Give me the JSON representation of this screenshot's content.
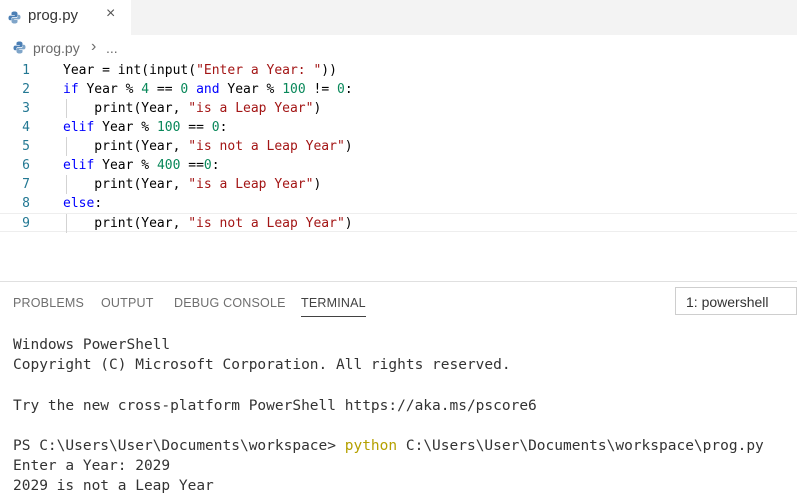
{
  "tab": {
    "filename": "prog.py",
    "close": "×"
  },
  "breadcrumb": {
    "file": "prog.py",
    "separator": "›",
    "more": "..."
  },
  "editor": {
    "lines": [
      {
        "n": "1",
        "segments": [
          [
            "t",
            "Year = int(input("
          ],
          [
            "s",
            "\"Enter a Year: \""
          ],
          [
            "t",
            "))"
          ]
        ],
        "indent": false
      },
      {
        "n": "2",
        "segments": [
          [
            "k",
            "if"
          ],
          [
            "t",
            " Year % "
          ],
          [
            "n",
            "4"
          ],
          [
            "t",
            " == "
          ],
          [
            "n",
            "0"
          ],
          [
            "t",
            " "
          ],
          [
            "k",
            "and"
          ],
          [
            "t",
            " Year % "
          ],
          [
            "n",
            "100"
          ],
          [
            "t",
            " != "
          ],
          [
            "n",
            "0"
          ],
          [
            "t",
            ":"
          ]
        ],
        "indent": false
      },
      {
        "n": "3",
        "segments": [
          [
            "t",
            "    print(Year, "
          ],
          [
            "s",
            "\"is a Leap Year\""
          ],
          [
            "t",
            ")"
          ]
        ],
        "indent": true
      },
      {
        "n": "4",
        "segments": [
          [
            "k",
            "elif"
          ],
          [
            "t",
            " Year % "
          ],
          [
            "n",
            "100"
          ],
          [
            "t",
            " == "
          ],
          [
            "n",
            "0"
          ],
          [
            "t",
            ":"
          ]
        ],
        "indent": false
      },
      {
        "n": "5",
        "segments": [
          [
            "t",
            "    print(Year, "
          ],
          [
            "s",
            "\"is not a Leap Year\""
          ],
          [
            "t",
            ")"
          ]
        ],
        "indent": true
      },
      {
        "n": "6",
        "segments": [
          [
            "k",
            "elif"
          ],
          [
            "t",
            " Year % "
          ],
          [
            "n",
            "400"
          ],
          [
            "t",
            " =="
          ],
          [
            "n",
            "0"
          ],
          [
            "t",
            ":"
          ]
        ],
        "indent": false
      },
      {
        "n": "7",
        "segments": [
          [
            "t",
            "    print(Year, "
          ],
          [
            "s",
            "\"is a Leap Year\""
          ],
          [
            "t",
            ")"
          ]
        ],
        "indent": true
      },
      {
        "n": "8",
        "segments": [
          [
            "k",
            "else"
          ],
          [
            "t",
            ":"
          ]
        ],
        "indent": false
      },
      {
        "n": "9",
        "segments": [
          [
            "t",
            "    print(Year, "
          ],
          [
            "s",
            "\"is not a Leap Year\""
          ],
          [
            "t",
            ")"
          ]
        ],
        "indent": true,
        "current": true
      }
    ]
  },
  "panel": {
    "tabs": [
      "PROBLEMS",
      "OUTPUT",
      "DEBUG CONSOLE",
      "TERMINAL"
    ],
    "active_tab": "TERMINAL",
    "terminal_select": "1: powershell"
  },
  "terminal": {
    "line1": "Windows PowerShell",
    "line2": "Copyright (C) Microsoft Corporation. All rights reserved.",
    "line3": "Try the new cross-platform PowerShell https://aka.ms/pscore6",
    "prompt": "PS C:\\Users\\User\\Documents\\workspace> ",
    "command": "python",
    "arg": " C:\\Users\\User\\Documents\\workspace\\prog.py",
    "out1": "Enter a Year: 2029",
    "out2": "2029 is not a Leap Year"
  }
}
